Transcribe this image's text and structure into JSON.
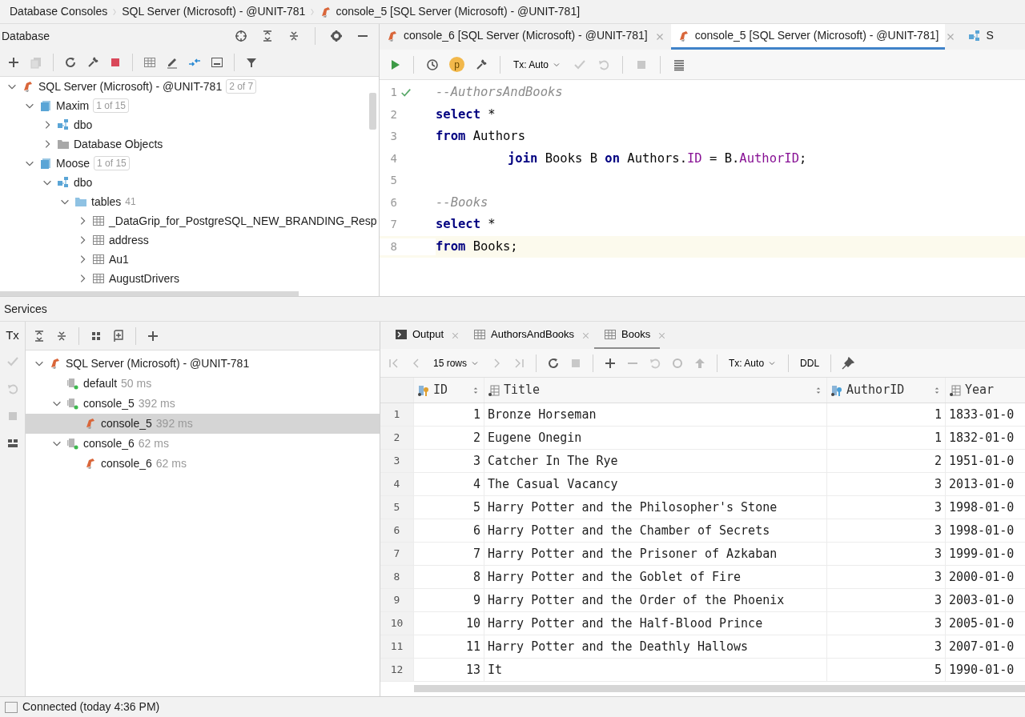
{
  "breadcrumbs": [
    "Database Consoles",
    "SQL Server (Microsoft) - @UNIT-781",
    "console_5 [SQL Server (Microsoft) - @UNIT-781]"
  ],
  "database_panel": {
    "title": "Database",
    "tree": [
      {
        "kind": "server",
        "label": "SQL Server (Microsoft) - @UNIT-781",
        "badge": "2 of 7",
        "expanded": true,
        "children": [
          {
            "kind": "database",
            "label": "Maxim",
            "badge": "1 of 15",
            "expanded": true,
            "children": [
              {
                "kind": "schema",
                "label": "dbo",
                "expanded": false
              },
              {
                "kind": "objects",
                "label": "Database Objects",
                "expanded": false
              }
            ]
          },
          {
            "kind": "database",
            "label": "Moose",
            "badge": "1 of 15",
            "expanded": true,
            "children": [
              {
                "kind": "schema",
                "label": "dbo",
                "expanded": true,
                "children": [
                  {
                    "kind": "folder",
                    "label": "tables",
                    "count": "41",
                    "expanded": true,
                    "children": [
                      {
                        "kind": "table",
                        "label": "_DataGrip_for_PostgreSQL_NEW_BRANDING_Resp",
                        "expanded": false
                      },
                      {
                        "kind": "table",
                        "label": "address",
                        "expanded": false
                      },
                      {
                        "kind": "table",
                        "label": "Au1",
                        "expanded": false
                      },
                      {
                        "kind": "table",
                        "label": "AugustDrivers",
                        "expanded": false
                      }
                    ]
                  }
                ]
              }
            ]
          }
        ]
      }
    ]
  },
  "editor": {
    "tabs": [
      {
        "label": "console_6 [SQL Server (Microsoft) - @UNIT-781]",
        "kind": "console",
        "selected": false
      },
      {
        "label": "console_5 [SQL Server (Microsoft) - @UNIT-781]",
        "kind": "console",
        "selected": true
      },
      {
        "label": "S",
        "kind": "schema",
        "selected": false
      }
    ],
    "toolbar": {
      "profile": "p",
      "tx": "Tx: Auto"
    },
    "lines": [
      {
        "number": "1",
        "ok": true,
        "current": false,
        "indent": false,
        "tokens": [
          {
            "kind": "comment",
            "text": "--AuthorsAndBooks"
          }
        ]
      },
      {
        "number": "2",
        "ok": false,
        "current": false,
        "indent": false,
        "tokens": [
          {
            "kind": "keyword",
            "text": "select"
          },
          {
            "kind": "plain",
            "text": " *"
          }
        ]
      },
      {
        "number": "3",
        "ok": false,
        "current": false,
        "indent": false,
        "tokens": [
          {
            "kind": "keyword",
            "text": "from"
          },
          {
            "kind": "plain",
            "text": " Authors"
          }
        ]
      },
      {
        "number": "4",
        "ok": false,
        "current": false,
        "indent": true,
        "tokens": [
          {
            "kind": "keyword",
            "text": "join"
          },
          {
            "kind": "plain",
            "text": " Books B "
          },
          {
            "kind": "keyword",
            "text": "on"
          },
          {
            "kind": "plain",
            "text": " Authors."
          },
          {
            "kind": "field",
            "text": "ID"
          },
          {
            "kind": "plain",
            "text": " = B."
          },
          {
            "kind": "field",
            "text": "AuthorID"
          },
          {
            "kind": "plain",
            "text": ";"
          }
        ]
      },
      {
        "number": "5",
        "ok": false,
        "current": false,
        "indent": false
      },
      {
        "number": "6",
        "ok": false,
        "current": false,
        "indent": false,
        "tokens": [
          {
            "kind": "comment",
            "text": "--Books"
          }
        ]
      },
      {
        "number": "7",
        "ok": false,
        "current": false,
        "indent": false,
        "tokens": [
          {
            "kind": "keyword",
            "text": "select"
          },
          {
            "kind": "plain",
            "text": " *"
          }
        ]
      },
      {
        "number": "8",
        "ok": false,
        "current": true,
        "indent": false,
        "tokens": [
          {
            "kind": "keyword",
            "text": "from"
          },
          {
            "kind": "plain",
            "text": " Books;"
          }
        ]
      }
    ]
  },
  "services": {
    "title": "Services",
    "tx": "Tx",
    "tree": [
      {
        "kind": "server",
        "label": "SQL Server (Microsoft) - @UNIT-781",
        "expanded": true,
        "selected": false,
        "children": [
          {
            "kind": "session",
            "label": "default",
            "time": "50 ms",
            "selected": false
          },
          {
            "kind": "session",
            "label": "console_5",
            "time": "392 ms",
            "expanded": true,
            "selected": false,
            "children": [
              {
                "kind": "console",
                "label": "console_5",
                "time": "392 ms",
                "selected": true
              }
            ]
          },
          {
            "kind": "session",
            "label": "console_6",
            "time": "62 ms",
            "expanded": true,
            "selected": false,
            "children": [
              {
                "kind": "console",
                "label": "console_6",
                "time": "62 ms",
                "selected": false
              }
            ]
          }
        ]
      }
    ]
  },
  "results": {
    "tabs": [
      {
        "label": "Output",
        "kind": "output",
        "selected": false
      },
      {
        "label": "AuthorsAndBooks",
        "kind": "grid",
        "selected": false
      },
      {
        "label": "Books",
        "kind": "grid",
        "selected": true
      }
    ],
    "toolbar": {
      "rows": "15 rows",
      "tx": "Tx: Auto",
      "ddl": "DDL"
    },
    "columns": [
      {
        "label": "ID",
        "kind": "key"
      },
      {
        "label": "Title",
        "kind": "column"
      },
      {
        "label": "AuthorID",
        "kind": "foreign"
      },
      {
        "label": "Year",
        "kind": "column"
      }
    ],
    "rows": [
      {
        "number": "1",
        "cells": [
          "1",
          "Bronze Horseman",
          "1",
          "1833-01-0"
        ]
      },
      {
        "number": "2",
        "cells": [
          "2",
          "Eugene Onegin",
          "1",
          "1832-01-0"
        ]
      },
      {
        "number": "3",
        "cells": [
          "3",
          "Catcher In The Rye",
          "2",
          "1951-01-0"
        ]
      },
      {
        "number": "4",
        "cells": [
          "4",
          "The Casual Vacancy",
          "3",
          "2013-01-0"
        ]
      },
      {
        "number": "5",
        "cells": [
          "5",
          "Harry Potter and the Philosopher's Stone",
          "3",
          "1998-01-0"
        ]
      },
      {
        "number": "6",
        "cells": [
          "6",
          "Harry Potter and the Chamber of Secrets",
          "3",
          "1998-01-0"
        ]
      },
      {
        "number": "7",
        "cells": [
          "7",
          "Harry Potter and the Prisoner of Azkaban",
          "3",
          "1999-01-0"
        ]
      },
      {
        "number": "8",
        "cells": [
          "8",
          "Harry Potter and the Goblet of Fire",
          "3",
          "2000-01-0"
        ]
      },
      {
        "number": "9",
        "cells": [
          "9",
          "Harry Potter and the Order of the Phoenix",
          "3",
          "2003-01-0"
        ]
      },
      {
        "number": "10",
        "cells": [
          "10",
          "Harry Potter and the Half-Blood Prince",
          "3",
          "2005-01-0"
        ]
      },
      {
        "number": "11",
        "cells": [
          "11",
          "Harry Potter and the Deathly Hallows",
          "3",
          "2007-01-0"
        ]
      },
      {
        "number": "12",
        "cells": [
          "13",
          "It",
          "5",
          "1990-01-0"
        ]
      }
    ]
  },
  "status_bar": {
    "text": "Connected (today 4:36 PM)"
  }
}
